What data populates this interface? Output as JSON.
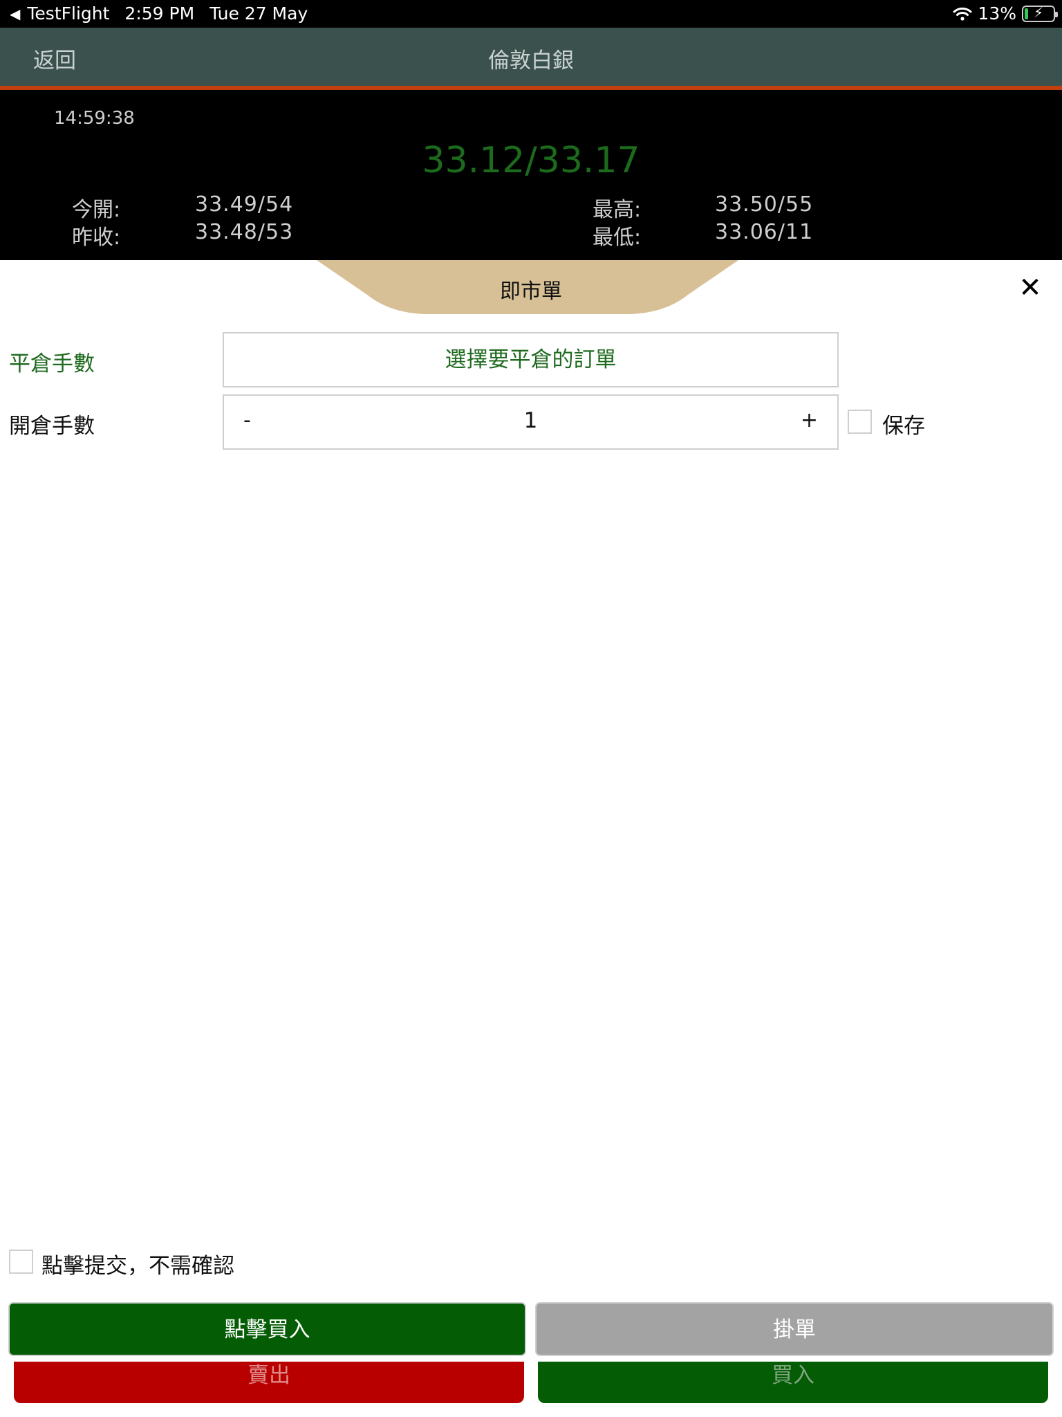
{
  "status_bar": {
    "app": "TestFlight",
    "time": "2:59 PM",
    "date": "Tue 27 May",
    "battery": "13%",
    "battery_level": 0.13
  },
  "nav": {
    "back_label": "返回",
    "title": "倫敦白銀"
  },
  "quote": {
    "time": "14:59:38",
    "price": "33.12/33.17",
    "open_label": "今開:",
    "open_value": "33.49/54",
    "prev_close_label": "昨收:",
    "prev_close_value": "33.48/53",
    "high_label": "最高:",
    "high_value": "33.50/55",
    "low_label": "最低:",
    "low_value": "33.06/11"
  },
  "order_type": "即市單",
  "form": {
    "close_lots_label": "平倉手數",
    "close_select_text": "選擇要平倉的訂單",
    "open_lots_label": "開倉手數",
    "minus": "-",
    "quantity": "1",
    "plus": "+",
    "save_label": "保存",
    "save_checked": false
  },
  "confirm": {
    "label": "點擊提交，不需確認",
    "checked": false
  },
  "buttons": {
    "click_buy": "點擊買入",
    "pending": "掛單",
    "sell": "賣出",
    "buy": "買入"
  },
  "colors": {
    "nav_bg": "#3b514d",
    "accent_line": "#c2400f",
    "price_green": "#1c6b1c",
    "buy_green": "#045c04",
    "sell_red": "#b90000",
    "tab_tan": "#d8c096",
    "pending_gray": "#a3a3a3"
  }
}
